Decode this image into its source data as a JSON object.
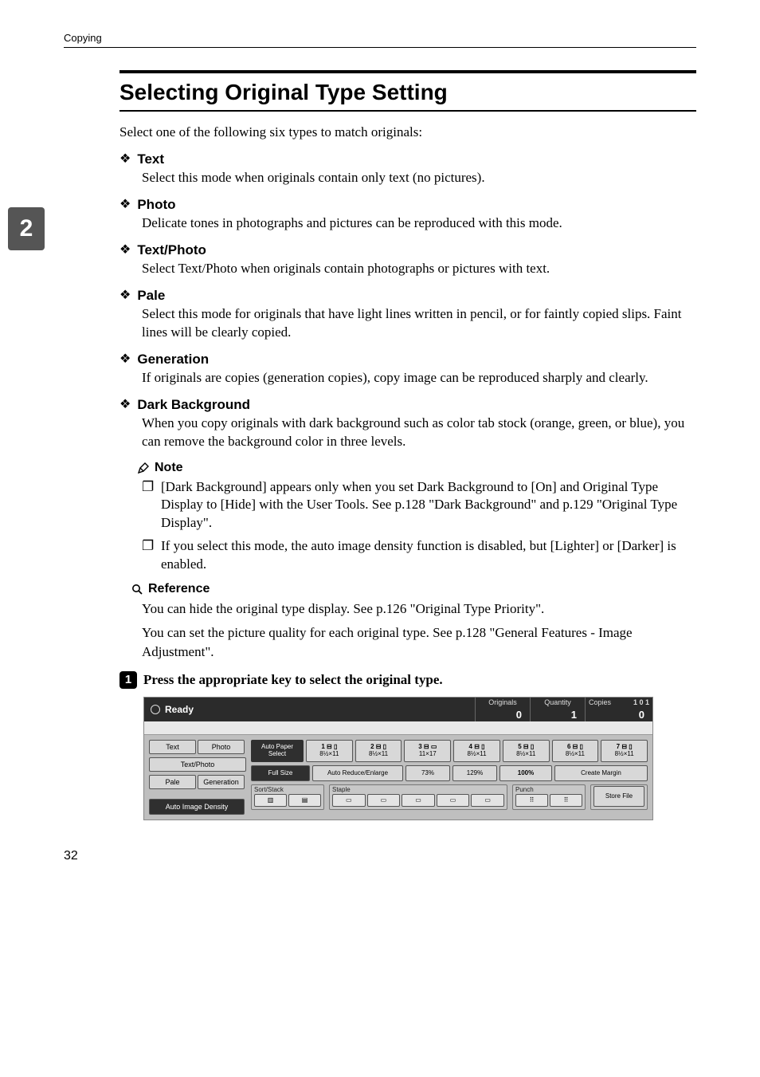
{
  "header": {
    "chapter_label": "Copying"
  },
  "chapter_tab": "2",
  "section_title": "Selecting Original Type Setting",
  "intro": "Select one of the following six types to match originals:",
  "types": [
    {
      "title": "Text",
      "body": "Select this mode when originals contain only text (no pictures)."
    },
    {
      "title": "Photo",
      "body": "Delicate tones in photographs and pictures can be reproduced with this mode."
    },
    {
      "title": "Text/Photo",
      "body": "Select Text/Photo when originals contain photographs or pictures with text."
    },
    {
      "title": "Pale",
      "body": "Select this mode for originals that have light lines written in pencil, or for faintly copied slips. Faint lines will be clearly copied."
    },
    {
      "title": "Generation",
      "body": "If originals are copies (generation copies), copy image can be reproduced sharply and clearly."
    },
    {
      "title": "Dark Background",
      "body": "When you copy originals with dark background such as color tab stock (orange, green, or blue), you can remove the background color in three levels."
    }
  ],
  "note_label": "Note",
  "note_items": [
    "[Dark Background] appears only when you set Dark Background to [On] and Original Type Display to [Hide] with the User Tools. See p.128 \"Dark Background\" and p.129 \"Original Type Display\".",
    "If you select this mode, the auto image density function is disabled, but [Lighter] or [Darker] is enabled."
  ],
  "reference_label": "Reference",
  "reference_body": [
    "You can hide the original type display. See p.126 \"Original Type Priority\".",
    "You can set the picture quality for each original type. See p.128 \"General Features - Image Adjustment\"."
  ],
  "step1_number": "1",
  "step1_text": "Press the appropriate key to select the original type.",
  "panel": {
    "ready": "Ready",
    "top": {
      "originals_label": "Originals",
      "originals_value": "0",
      "quantity_label": "Quantity",
      "quantity_value": "1",
      "copies_label": "Copies",
      "copies_value": "0",
      "big_value": "1 0 1"
    },
    "type_buttons": {
      "text": "Text",
      "photo": "Photo",
      "textphoto": "Text/Photo",
      "pale": "Pale",
      "generation": "Generation",
      "auto_image_density": "Auto Image Density"
    },
    "auto_paper": {
      "line1": "Auto Paper",
      "line2": "Select"
    },
    "trays": [
      {
        "slot": "1 ⊟ ▯",
        "size": "8½×11"
      },
      {
        "slot": "2 ⊟ ▯",
        "size": "8½×11"
      },
      {
        "slot": "3 ⊟ ▭",
        "size": "11×17"
      },
      {
        "slot": "4 ⊟ ▯",
        "size": "8½×11"
      },
      {
        "slot": "5 ⊟ ▯",
        "size": "8½×11"
      },
      {
        "slot": "6 ⊟ ▯",
        "size": "8½×11"
      },
      {
        "slot": "7 ⊟ ▯",
        "size": "8½×11"
      }
    ],
    "zoom": {
      "full_size": "Full Size",
      "auto_reduce_enlarge": "Auto Reduce/Enlarge",
      "p73": "73%",
      "p129": "129%",
      "p100": "100%",
      "create_margin": "Create Margin"
    },
    "groups": {
      "sort_stack": "Sort/Stack",
      "staple": "Staple",
      "punch": "Punch",
      "store_file": "Store File"
    }
  },
  "page_number": "32"
}
